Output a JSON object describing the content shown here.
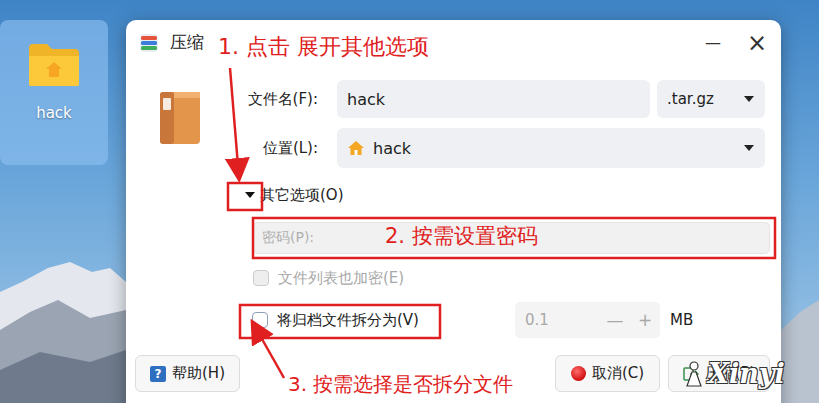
{
  "desktop": {
    "icons": [
      {
        "label": "hack",
        "selected": true
      }
    ]
  },
  "window": {
    "title": "压缩",
    "controls": [
      "—",
      "×"
    ]
  },
  "form": {
    "filename": {
      "label": "文件名(F):",
      "value": "hack",
      "format": ".tar.gz"
    },
    "location": {
      "label": "位置(L):",
      "value": "hack"
    },
    "more_options": {
      "label": "其它选项(O)",
      "expanded": true
    },
    "password": {
      "placeholder": "密码(P):",
      "disabled": true
    },
    "encrypt_list": {
      "label": "文件列表也加密(E)",
      "checked": false,
      "disabled": true
    },
    "split": {
      "label": "将归档文件拆分为(V)",
      "checked": false,
      "value": "0.1",
      "minus": "—",
      "plus": "+",
      "unit": "MB",
      "spinner_disabled": true
    }
  },
  "buttons": [
    {
      "label": "帮助(H)",
      "kind": "help",
      "icon": "?"
    },
    {
      "label": "取消(C)",
      "kind": "cancel"
    },
    {
      "label": "压缩(P)",
      "kind": "confirm"
    }
  ],
  "annotations": [
    {
      "label": "1. 点击 展开其他选项"
    },
    {
      "label": "2. 按需设置密码"
    },
    {
      "label": "3. 按需选择是否拆分文件"
    }
  ],
  "watermark": "Xinyi"
}
